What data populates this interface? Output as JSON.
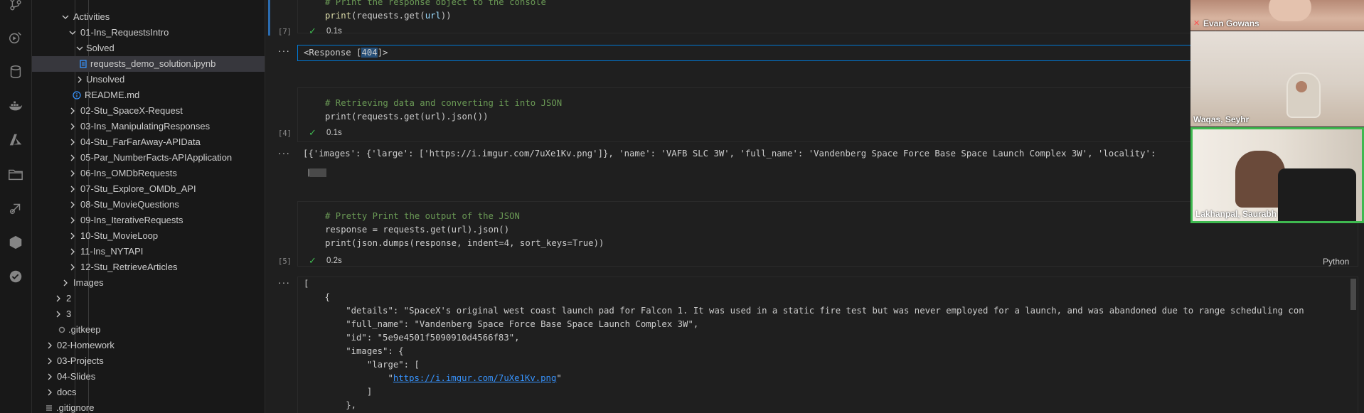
{
  "activity_bar": {
    "icons": [
      "source-control-icon",
      "run-debug-icon",
      "database-icon",
      "docker-icon",
      "azure-icon",
      "folder-icon",
      "remote-icon",
      "extensions-icon",
      "check-icon"
    ]
  },
  "explorer": {
    "items": [
      {
        "label": "Activities",
        "type": "folder",
        "open": true
      },
      {
        "label": "01-Ins_RequestsIntro",
        "type": "folder",
        "open": true
      },
      {
        "label": "Solved",
        "type": "folder",
        "open": true
      },
      {
        "label": "requests_demo_solution.ipynb",
        "type": "notebook"
      },
      {
        "label": "Unsolved",
        "type": "folder",
        "open": false
      },
      {
        "label": "README.md",
        "type": "info"
      },
      {
        "label": "02-Stu_SpaceX-Request",
        "type": "folder",
        "open": false
      },
      {
        "label": "03-Ins_ManipulatingResponses",
        "type": "folder",
        "open": false
      },
      {
        "label": "04-Stu_FarFarAway-APIData",
        "type": "folder",
        "open": false
      },
      {
        "label": "05-Par_NumberFacts-APIApplication",
        "type": "folder",
        "open": false
      },
      {
        "label": "06-Ins_OMDbRequests",
        "type": "folder",
        "open": false
      },
      {
        "label": "07-Stu_Explore_OMDb_API",
        "type": "folder",
        "open": false
      },
      {
        "label": "08-Stu_MovieQuestions",
        "type": "folder",
        "open": false
      },
      {
        "label": "09-Ins_IterativeRequests",
        "type": "folder",
        "open": false
      },
      {
        "label": "10-Stu_MovieLoop",
        "type": "folder",
        "open": false
      },
      {
        "label": "11-Ins_NYTAPI",
        "type": "folder",
        "open": false
      },
      {
        "label": "12-Stu_RetrieveArticles",
        "type": "folder",
        "open": false
      },
      {
        "label": "Images",
        "type": "folder",
        "open": false
      },
      {
        "label": "2",
        "type": "folder",
        "open": false
      },
      {
        "label": "3",
        "type": "folder",
        "open": false
      },
      {
        "label": ".gitkeep",
        "type": "file"
      },
      {
        "label": "02-Homework",
        "type": "folder",
        "open": false
      },
      {
        "label": "03-Projects",
        "type": "folder",
        "open": false
      },
      {
        "label": "04-Slides",
        "type": "folder",
        "open": false
      },
      {
        "label": "docs",
        "type": "folder",
        "open": false
      },
      {
        "label": ".gitignore",
        "type": "list"
      }
    ]
  },
  "notebook": {
    "cell1": {
      "comment": "# Print the response object to the console",
      "code_func": "print",
      "code_mid": "(requests.get(",
      "code_var": "url",
      "code_end": "))",
      "count": "[7]",
      "time": "0.1s",
      "output_prefix": "<Response [",
      "output_code": "404",
      "output_suffix": "]>"
    },
    "cell2": {
      "comment": "# Retrieving data and converting it into JSON",
      "line": "print(requests.get(url).json())",
      "count": "[4]",
      "time": "0.1s",
      "output": "[{'images': {'large': ['https://i.imgur.com/7uXe1Kv.png']}, 'name': 'VAFB SLC 3W', 'full_name': 'Vandenberg Space Force Base Space Launch Complex 3W', 'locality':"
    },
    "cell3": {
      "comment": "# Pretty Print the output of the JSON",
      "line1": "response = requests.get(url).json()",
      "line2": "print(json.dumps(response, indent=4, sort_keys=True))",
      "count": "[5]",
      "time": "0.2s",
      "language": "Python",
      "output_lines": [
        "[",
        "    {",
        "        \"details\": \"SpaceX's original west coast launch pad for Falcon 1. It was used in a static fire test but was never employed for a launch, and was abandoned due to range scheduling con",
        "        \"full_name\": \"Vandenberg Space Force Base Space Launch Complex 3W\",",
        "        \"id\": \"5e9e4501f5090910d4566f83\",",
        "        \"images\": {",
        "            \"large\": [",
        "                \"",
        "            ]",
        "        },"
      ],
      "link": "https://i.imgur.com/7uXe1Kv.png"
    }
  },
  "video": {
    "participants": [
      {
        "name": "Evan Gowans",
        "muted": true
      },
      {
        "name": "Waqas, Seyhr",
        "muted": false
      },
      {
        "name": "Lakhanpal, Saurabh",
        "muted": false,
        "active": true
      }
    ]
  },
  "colors": {
    "accent": "#0078d4",
    "active_speaker": "#3fb950",
    "selection": "#37373d"
  }
}
